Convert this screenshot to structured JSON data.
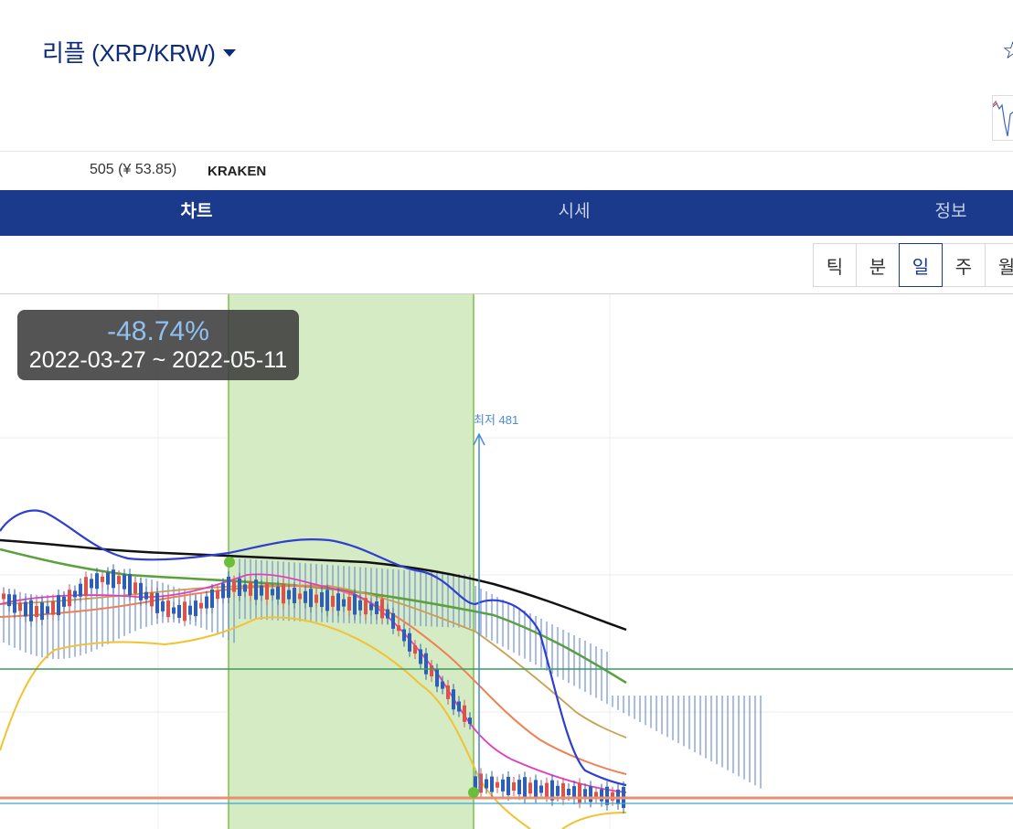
{
  "header": {
    "title": "리플 (XRP/KRW)",
    "star_icon": "☆"
  },
  "sub": {
    "price_ref": "505 (¥ 53.85)",
    "exchange": "KRAKEN"
  },
  "tabs": [
    {
      "label": "차트",
      "active": true
    },
    {
      "label": "시세",
      "active": false
    },
    {
      "label": "정보",
      "active": false
    }
  ],
  "periods": [
    {
      "label": "틱",
      "active": false
    },
    {
      "label": "분",
      "active": false
    },
    {
      "label": "일",
      "active": true
    },
    {
      "label": "주",
      "active": false
    },
    {
      "label": "월",
      "active": false
    }
  ],
  "chart": {
    "tooltip_pct": "-48.74%",
    "tooltip_range": "2022-03-27 ~ 2022-05-11",
    "low_label": "최저 481",
    "colors": {
      "selection": "#cfe8bf",
      "selection_edge": "#7cc04a",
      "candle_up": "#d9534f",
      "candle_down": "#2f5fb5",
      "ma_black": "#111111",
      "ma_green": "#5aa03c",
      "ma_orange": "#f08050",
      "ma_gold": "#c8a050",
      "ma_magenta": "#e040c0",
      "bollinger": "#3040d0",
      "lower_band": "#f0c030",
      "cloud": "#6f8fe0"
    }
  }
}
